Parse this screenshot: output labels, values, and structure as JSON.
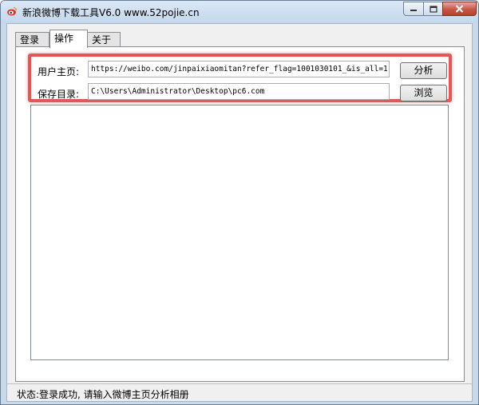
{
  "window": {
    "title": "新浪微博下载工具V6.0 www.52pojie.cn"
  },
  "tabs": [
    {
      "label": "登录"
    },
    {
      "label": "操作"
    },
    {
      "label": "关于"
    }
  ],
  "form": {
    "user_home_label": "用户主页:",
    "user_home_value": "https://weibo.com/jinpaixiaomitan?refer_flag=1001030101_&is_all=1",
    "analyze_button": "分析",
    "save_dir_label": "保存目录:",
    "save_dir_value": "C:\\Users\\Administrator\\Desktop\\pc6.com",
    "browse_button": "浏览"
  },
  "status": {
    "text": "状态:登录成功, 请输入微博主页分析相册"
  },
  "colors": {
    "highlight": "#e25858",
    "close_button": "#c85644"
  }
}
